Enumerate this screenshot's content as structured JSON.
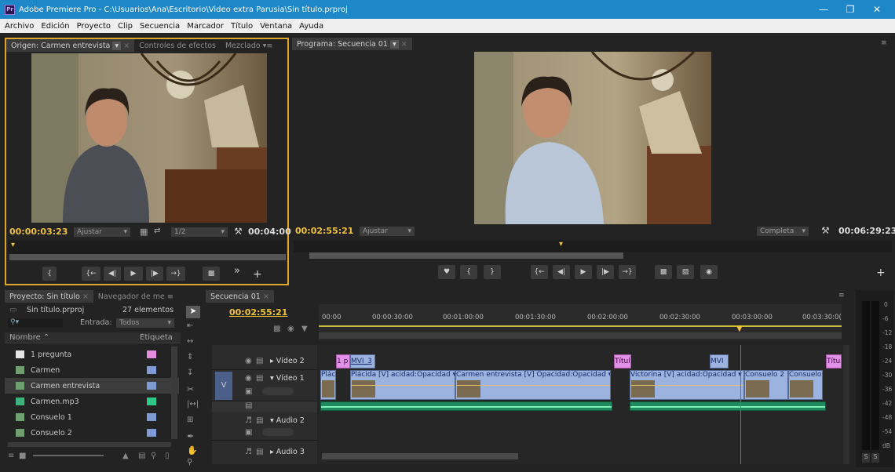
{
  "window": {
    "title": "Adobe Premiere Pro - C:\\Usuarios\\Ana\\Escritorio\\Video extra Parusia\\Sin título.prproj",
    "app_badge": "Pr"
  },
  "menu": [
    "Archivo",
    "Edición",
    "Proyecto",
    "Clip",
    "Secuencia",
    "Marcador",
    "Título",
    "Ventana",
    "Ayuda"
  ],
  "source": {
    "tabs": [
      "Origen: Carmen entrevista",
      "Controles de efectos",
      "Mezclado"
    ],
    "timecode_current": "00:00:03:23",
    "fit": "Ajustar",
    "resolution": "1/2",
    "timecode_duration": "00:04:00",
    "playhead_position": 0.0
  },
  "program": {
    "tab": "Programa: Secuencia 01",
    "timecode_current": "00:02:55:21",
    "fit": "Ajustar",
    "quality": "Completa",
    "timecode_duration": "00:06:29:23",
    "playhead_position": 0.45
  },
  "project": {
    "tabs": [
      "Proyecto: Sin título",
      "Navegador de me"
    ],
    "filename": "Sin título.prproj",
    "item_count": "27 elementos",
    "search_placeholder": "",
    "filter_label": "Entrada:",
    "filter_value": "Todos",
    "col_name": "Nombre",
    "col_label": "Etiqueta",
    "items": [
      {
        "name": "1 pregunta",
        "type": "title",
        "label_color": "#e58ee0"
      },
      {
        "name": "Carmen",
        "type": "sequence",
        "label_color": "#7f9bd6"
      },
      {
        "name": "Carmen entrevista",
        "type": "sequence",
        "label_color": "#7f9bd6",
        "selected": true
      },
      {
        "name": "Carmen.mp3",
        "type": "audio",
        "label_color": "#2fc98a"
      },
      {
        "name": "Consuelo 1",
        "type": "sequence",
        "label_color": "#7f9bd6"
      },
      {
        "name": "Consuelo 2",
        "type": "sequence",
        "label_color": "#7f9bd6"
      }
    ]
  },
  "timeline": {
    "tab": "Secuencia 01",
    "timecode": "00:02:55:21",
    "ruler": [
      "00:00",
      "00:00:30:00",
      "00:01:00:00",
      "00:01:30:00",
      "00:02:00:00",
      "00:02:30:00",
      "00:03:00:00",
      "00:03:30:0("
    ],
    "tracks": {
      "video2": "Vídeo 2",
      "video1": "Vídeo 1",
      "v_target": "V",
      "audio2": "Audio 2",
      "audio3": "Audio 3"
    },
    "clips": {
      "p1": "1 p",
      "mvi3": "MVI_3",
      "titu1": "Títul",
      "mvi2": "MVI",
      "titu2": "Títul",
      "plac": "Plác",
      "placida": "Plácida [V]",
      "opac1": "acidad:Opacidad",
      "carmen": "Carmen entrevista [V]",
      "opac2": "Opacidad:Opacidad",
      "victorina": "Victorina [V]",
      "opac3": "acidad:Opacidad",
      "consuelo2": "Consuelo 2",
      "consuelo": "Consuelo"
    }
  },
  "meters": {
    "labels": [
      "0",
      "-6",
      "-12",
      "-18",
      "-24",
      "-30",
      "-36",
      "-42",
      "-48",
      "-54",
      "dB"
    ],
    "solo": [
      "S",
      "S"
    ]
  },
  "colors": {
    "timecode": "#f0c23a",
    "video_clip": "#9bb3de",
    "title_clip": "#e391e8",
    "audio_clip": "#1e8a5e",
    "playhead": "#e83e3e",
    "titlebar": "#1e87c8"
  }
}
